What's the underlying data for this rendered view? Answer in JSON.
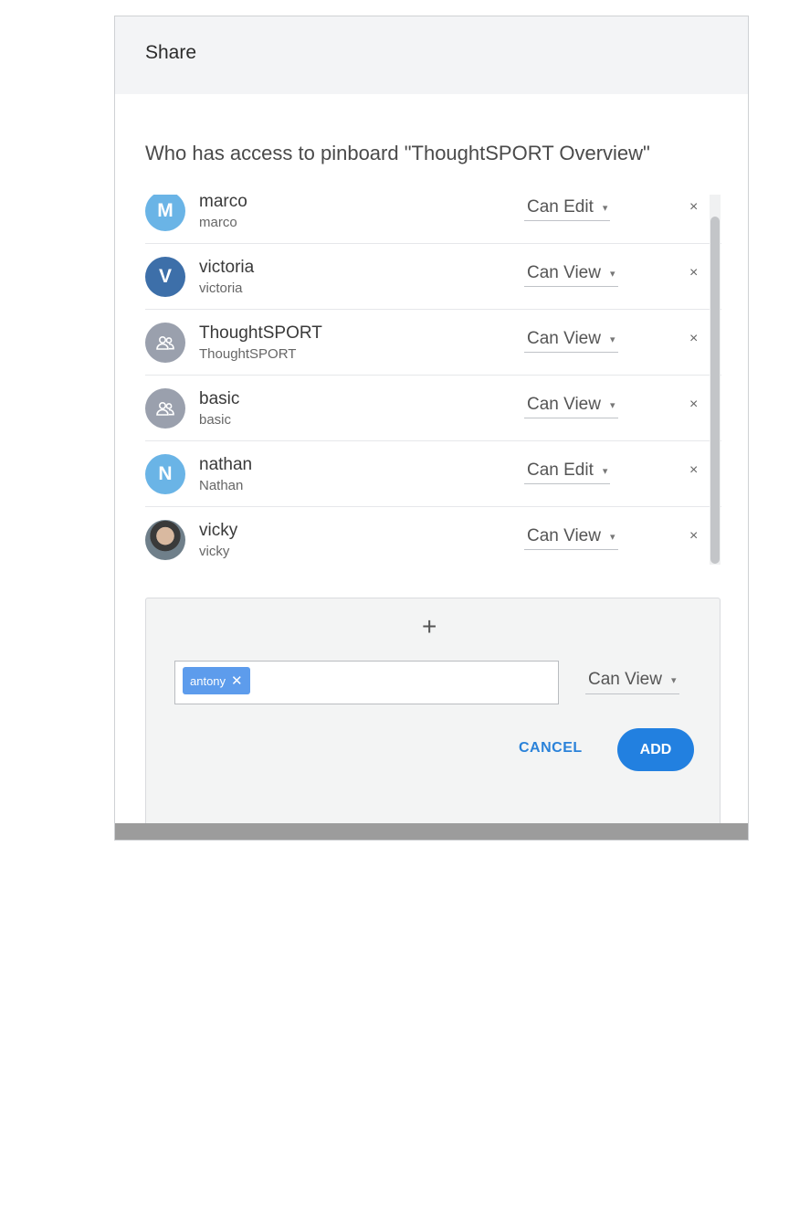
{
  "dialog": {
    "title": "Share",
    "access_heading": "Who has access to  pinboard \"ThoughtSPORT Overview\""
  },
  "users": [
    {
      "name": "marco",
      "sub": "marco",
      "avatar": "M",
      "avatar_style": "light",
      "permission": "Can Edit"
    },
    {
      "name": "victoria",
      "sub": "victoria",
      "avatar": "V",
      "avatar_style": "dark",
      "permission": "Can View"
    },
    {
      "name": "ThoughtSPORT",
      "sub": "ThoughtSPORT",
      "avatar": "group-icon",
      "avatar_style": "group",
      "permission": "Can View"
    },
    {
      "name": "basic",
      "sub": "basic",
      "avatar": "group-icon",
      "avatar_style": "group",
      "permission": "Can View"
    },
    {
      "name": "nathan",
      "sub": "Nathan",
      "avatar": "N",
      "avatar_style": "light",
      "permission": "Can Edit"
    },
    {
      "name": "vicky",
      "sub": "vicky",
      "avatar": "photo",
      "avatar_style": "photo",
      "permission": "Can View"
    }
  ],
  "remove_glyph": "×",
  "add_panel": {
    "plus": "+",
    "token": "antony",
    "token_remove": "✕",
    "permission": "Can View",
    "cancel_label": "CANCEL",
    "add_label": "ADD"
  },
  "caret": "▾",
  "colors": {
    "accent": "#2280e0",
    "token": "#5d9cec",
    "avatar_light": "#6ab4e6",
    "avatar_dark": "#3d6fa9",
    "avatar_group": "#9aa0ad"
  }
}
